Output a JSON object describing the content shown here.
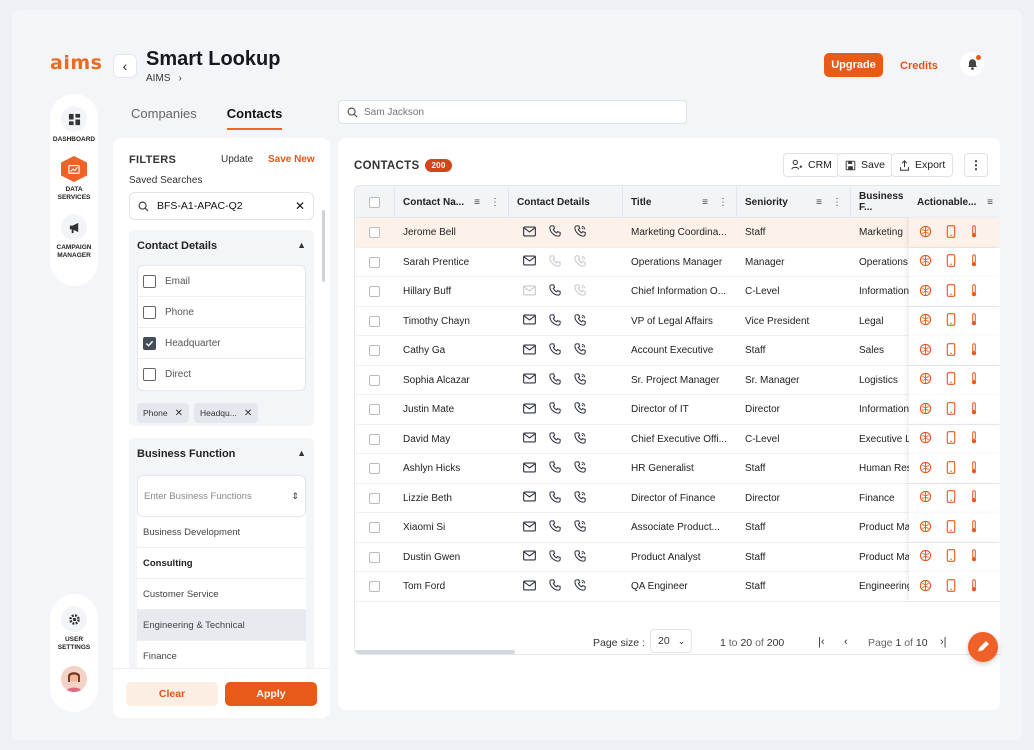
{
  "app": {
    "logo": "aims",
    "title": "Smart Lookup",
    "breadcrumb": "AIMS",
    "upgrade_label": "Upgrade",
    "credits_label": "Credits",
    "accent": "#e85a17"
  },
  "rail": {
    "items": [
      {
        "label": "DASHBOARD",
        "icon": "dashboard-icon"
      },
      {
        "label": "DATA SERVICES",
        "icon": "data-services-icon"
      },
      {
        "label": "CAMPAIGN MANAGER",
        "icon": "megaphone-icon"
      }
    ],
    "settings_label": "USER SETTINGS"
  },
  "tabs": [
    {
      "label": "Companies"
    },
    {
      "label": "Contacts"
    }
  ],
  "search": {
    "placeholder": "Sam Jackson"
  },
  "filters": {
    "title": "FILTERS",
    "update": "Update",
    "save_new": "Save New",
    "saved_searches_label": "Saved Searches",
    "saved_search_value": "BFS-A1-APAC-Q2",
    "contact_details": {
      "title": "Contact Details",
      "options": [
        {
          "label": "Email",
          "checked": false
        },
        {
          "label": "Phone",
          "checked": false
        },
        {
          "label": "Headquarter",
          "checked": true
        },
        {
          "label": "Direct",
          "checked": false
        }
      ],
      "chips": [
        "Phone",
        "Headqu..."
      ]
    },
    "business_function": {
      "title": "Business Function",
      "placeholder": "Enter Business Functions",
      "options": [
        "Business Development",
        "Consulting",
        "Customer Service",
        "Engineering & Technical",
        "Finance"
      ]
    },
    "clear_label": "Clear",
    "apply_label": "Apply"
  },
  "contacts": {
    "title": "CONTACTS",
    "count": "200",
    "crm_label": "CRM",
    "save_label": "Save",
    "export_label": "Export",
    "columns": [
      "Contact Na...",
      "Contact Details",
      "Title",
      "Seniority",
      "Business F...",
      "Actionable..."
    ],
    "rows": [
      {
        "name": "Jerome Bell",
        "title": "Marketing Coordina...",
        "seniority": "Staff",
        "bf": "Marketing"
      },
      {
        "name": "Sarah Prentice",
        "title": "Operations Manager",
        "seniority": "Manager",
        "bf": "Operations"
      },
      {
        "name": "Hillary Buff",
        "title": "Chief Information O...",
        "seniority": "C-Level",
        "bf": "Information"
      },
      {
        "name": "Timothy Chayn",
        "title": "VP of Legal Affairs",
        "seniority": "Vice President",
        "bf": "Legal"
      },
      {
        "name": "Cathy Ga",
        "title": "Account Executive",
        "seniority": "Staff",
        "bf": "Sales"
      },
      {
        "name": " Sophia Alcazar",
        "title": "Sr. Project Manager",
        "seniority": "Sr. Manager",
        "bf": "Logistics"
      },
      {
        "name": "Justin Mate",
        "title": "Director of IT",
        "seniority": "Director",
        "bf": "Information"
      },
      {
        "name": "David May",
        "title": "Chief Executive Offi...",
        "seniority": "C-Level",
        "bf": "Executive L"
      },
      {
        "name": "Ashlyn Hicks",
        "title": "HR Generalist",
        "seniority": "Staff",
        "bf": "Human Res"
      },
      {
        "name": "Lizzie Beth",
        "title": "Director of Finance",
        "seniority": "Director",
        "bf": "Finance"
      },
      {
        "name": "Xiaomi Si",
        "title": "Associate Product...",
        "seniority": "Staff",
        "bf": "Product Ma"
      },
      {
        "name": "Dustin Gwen",
        "title": "Product Analyst",
        "seniority": "Staff",
        "bf": "Product Ma"
      },
      {
        "name": "Tom Ford",
        "title": "QA Engineer",
        "seniority": "Staff",
        "bf": "Engineering"
      }
    ],
    "pager": {
      "size_label": "Page size :",
      "size": "20",
      "range_start": "1",
      "to_word": "to",
      "range_end": "20",
      "of_word": "of",
      "total": "200",
      "page_word": "Page",
      "page": "1",
      "pages": "10"
    }
  }
}
